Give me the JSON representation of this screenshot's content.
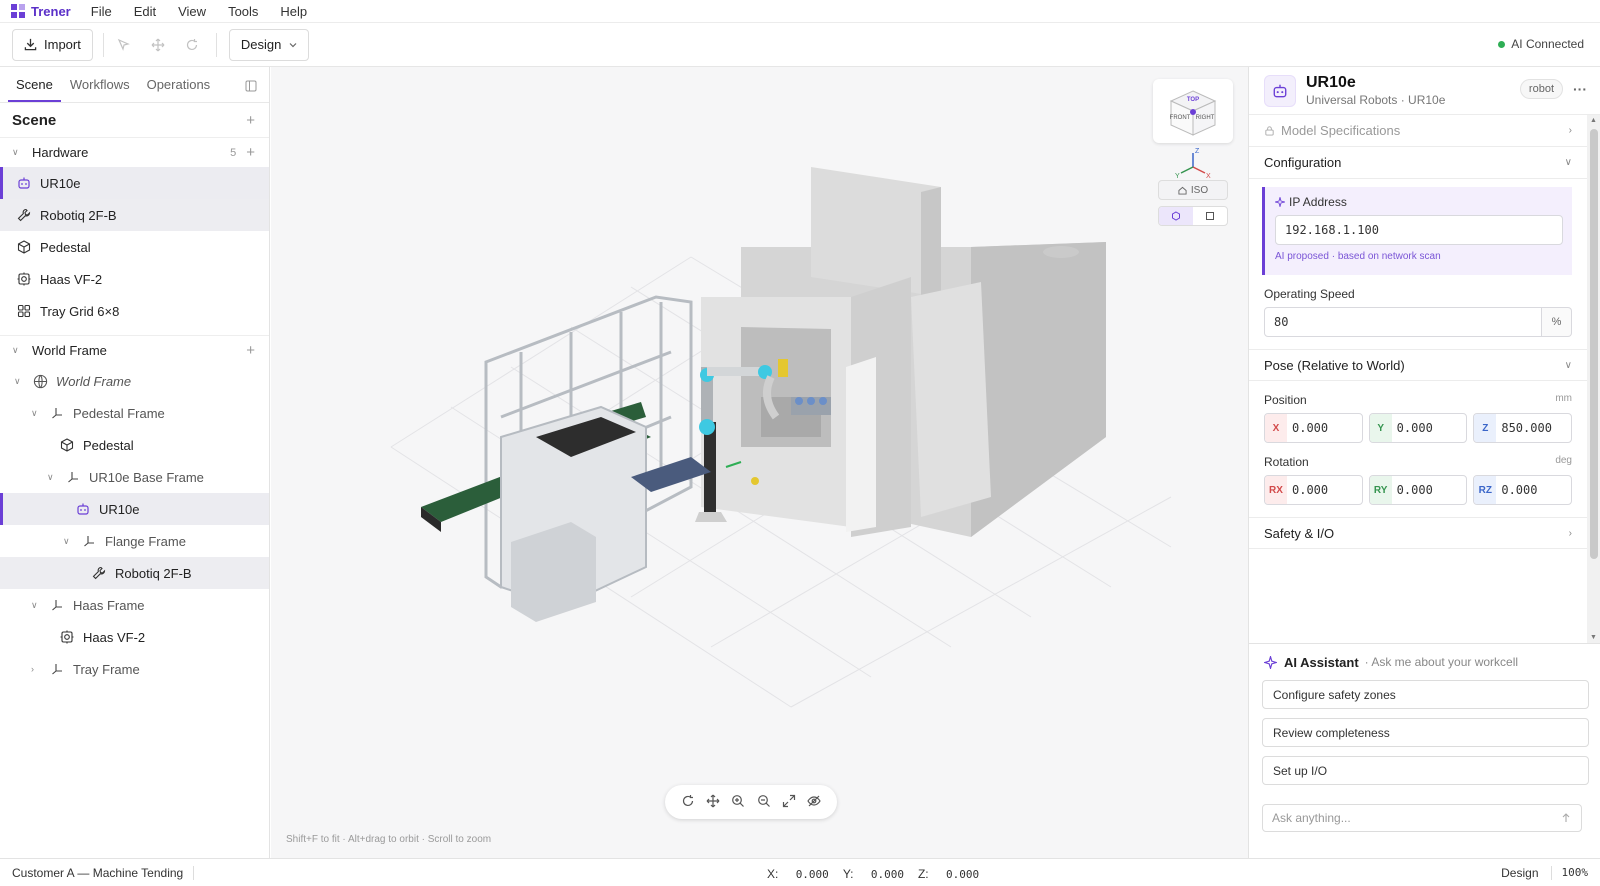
{
  "app": {
    "name": "Trener"
  },
  "menu": [
    "File",
    "Edit",
    "View",
    "Tools",
    "Help"
  ],
  "toolbar": {
    "import_label": "Import",
    "mode_label": "Design",
    "ai_status": "AI Connected"
  },
  "left": {
    "tabs": [
      "Scene",
      "Workflows",
      "Operations"
    ],
    "scene_title": "Scene",
    "hardware": {
      "label": "Hardware",
      "count": "5",
      "items": [
        "UR10e",
        "Robotiq 2F-B",
        "Pedestal",
        "Haas VF-2",
        "Tray Grid 6×8"
      ]
    },
    "world": {
      "label": "World Frame",
      "tree": [
        "World Frame",
        "Pedestal Frame",
        "Pedestal",
        "UR10e Base Frame",
        "UR10e",
        "Flange Frame",
        "Robotiq 2F-B",
        "Haas Frame",
        "Haas VF-2",
        "Tray Frame"
      ]
    }
  },
  "viewport": {
    "cube": {
      "top": "TOP",
      "front": "FRONT",
      "right": "RIGHT"
    },
    "axes": {
      "x": "X",
      "y": "Y",
      "z": "Z"
    },
    "iso_label": "ISO",
    "hint": "Shift+F to fit · Alt+drag to orbit · Scroll to zoom"
  },
  "inspector": {
    "title": "UR10e",
    "subtitle": "Universal Robots · UR10e",
    "badge": "robot",
    "sections": {
      "model_specs": "Model Specifications",
      "configuration": "Configuration",
      "pose": "Pose (Relative to World)",
      "safety": "Safety & I/O"
    },
    "ip": {
      "label": "IP Address",
      "value": "192.168.1.100",
      "note": "AI proposed · based on network scan"
    },
    "speed": {
      "label": "Operating Speed",
      "value": "80",
      "unit": "%"
    },
    "position": {
      "label": "Position",
      "unit": "mm",
      "x": "0.000",
      "y": "0.000",
      "z": "850.000"
    },
    "rotation": {
      "label": "Rotation",
      "unit": "deg",
      "rx": "0.000",
      "ry": "0.000",
      "rz": "0.000"
    },
    "tags": {
      "x": "X",
      "y": "Y",
      "z": "Z",
      "rx": "RX",
      "ry": "RY",
      "rz": "RZ"
    }
  },
  "assistant": {
    "title": "AI Assistant",
    "subtitle": "· Ask me about your workcell",
    "suggestions": [
      "Configure safety zones",
      "Review completeness",
      "Set up I/O"
    ],
    "placeholder": "Ask anything..."
  },
  "status": {
    "project": "Customer A — Machine Tending",
    "x_label": "X:",
    "x": "0.000",
    "y_label": "Y:",
    "y": "0.000",
    "z_label": "Z:",
    "z": "0.000",
    "mode": "Design",
    "zoom": "100%"
  },
  "colors": {
    "accent": "#6b3fd6",
    "ai_ok": "#2fae55"
  }
}
